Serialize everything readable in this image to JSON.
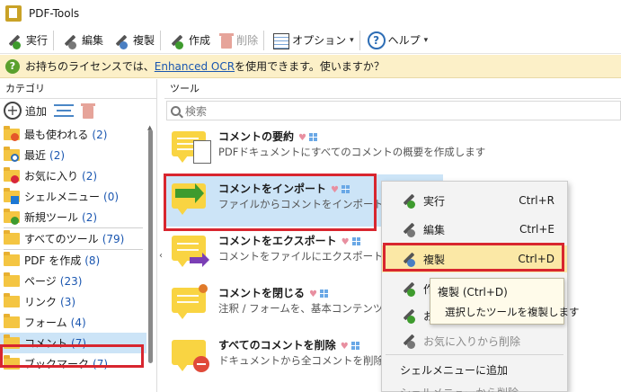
{
  "window": {
    "title": "PDF-Tools"
  },
  "toolbar": {
    "run": "実行",
    "edit": "編集",
    "duplicate": "複製",
    "create": "作成",
    "delete": "削除",
    "options": "オプション",
    "help": "ヘルプ",
    "help_glyph": "?"
  },
  "infobar": {
    "icon_glyph": "?",
    "text_before": "お持ちのライセンスでは、",
    "link": "Enhanced OCR",
    "text_after": " を使用できます。使いますか？"
  },
  "categories": {
    "header": "カテゴリ",
    "add_label": "追加",
    "add_glyph": "+",
    "items": [
      {
        "label": "最も使われる",
        "count": "(2)"
      },
      {
        "label": "最近",
        "count": "(2)"
      },
      {
        "label": "お気に入り",
        "count": "(2)"
      },
      {
        "label": "シェルメニュー",
        "count": "(0)"
      },
      {
        "label": "新規ツール",
        "count": "(2)"
      },
      {
        "label": "すべてのツール",
        "count": "(79)"
      },
      {
        "label": "PDF を作成",
        "count": "(8)"
      },
      {
        "label": "ページ",
        "count": "(23)"
      },
      {
        "label": "リンク",
        "count": "(3)"
      },
      {
        "label": "フォーム",
        "count": "(4)"
      },
      {
        "label": "コメント",
        "count": "(7)"
      },
      {
        "label": "ブックマーク",
        "count": "(7)"
      }
    ],
    "selected": "コメント"
  },
  "tools": {
    "header": "ツール",
    "search_placeholder": "検索",
    "items": [
      {
        "title": "コメントの要約",
        "desc": "PDFドキュメントにすべてのコメントの概要を作成します"
      },
      {
        "title": "コメントをインポート",
        "desc": "ファイルからコメントをインポート"
      },
      {
        "title": "コメントをエクスポート",
        "desc": "コメントをファイルにエクスポート"
      },
      {
        "title": "コメントを閉じる",
        "desc": "注釈 / フォームを、基本コンテンツ項目に"
      },
      {
        "title": "すべてのコメントを削除",
        "desc": "ドキュメントから全コメントを削除"
      }
    ]
  },
  "context_menu": {
    "run": {
      "label": "実行",
      "shortcut": "Ctrl+R"
    },
    "edit": {
      "label": "編集",
      "shortcut": "Ctrl+E"
    },
    "duplicate": {
      "label": "複製",
      "shortcut": "Ctrl+D"
    },
    "create_partial": "作",
    "fav_partial": "お",
    "remove_favorite": "お気に入りから削除",
    "add_shell": "シェルメニューに追加",
    "remove_shell": "シェルメニューから削除"
  },
  "tooltip": {
    "title": "複製 (Ctrl+D)",
    "desc": "選択したツールを複製します"
  },
  "colors": {
    "highlight_red": "#d8262f",
    "selection_blue": "#cce4f7",
    "menu_active": "#fbe8a6",
    "link_blue": "#1a56b0"
  }
}
